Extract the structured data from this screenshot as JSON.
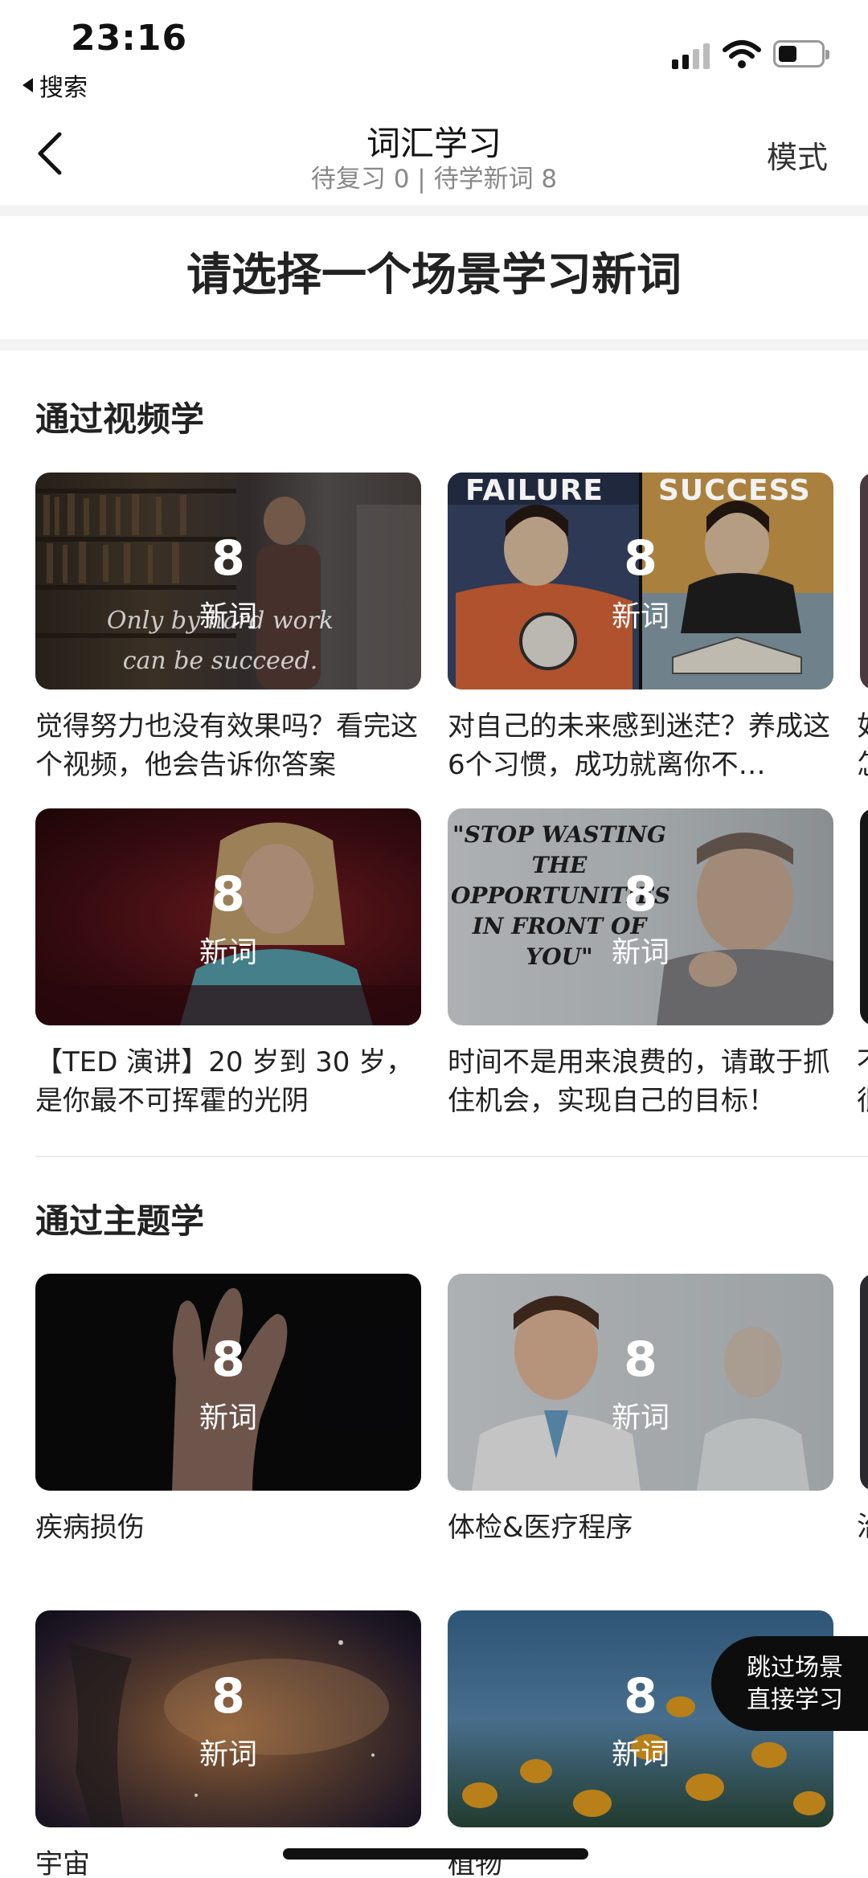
{
  "status_bar": {
    "time": "23:16",
    "back_app": "搜索"
  },
  "nav": {
    "title": "词汇学习",
    "subtitle": "待复习 0 | 待学新词 8",
    "mode_label": "模式"
  },
  "prompt": "请选择一个场景学习新词",
  "video_section": {
    "title": "通过视频学",
    "cards": [
      {
        "count": "8",
        "unit": "新词",
        "caption": "觉得努力也没有效果吗？看完这个视频，他会告诉你答案"
      },
      {
        "count": "8",
        "unit": "新词",
        "caption": "对自己的未来感到迷茫？养成这6个习惯，成功就离你不…"
      },
      {
        "count": "8",
        "unit": "新词",
        "caption": "【TED 演讲】20 岁到 30 岁，是你最不可挥霍的光阴"
      },
      {
        "count": "8",
        "unit": "新词",
        "caption": "时间不是用来浪费的，请敢于抓住机会，实现自己的目标！"
      }
    ],
    "peek_captions": [
      "如怎",
      "不很"
    ]
  },
  "thumb_text": {
    "card1": "Only by hard work can be succeed.",
    "card2_left": "FAILURE",
    "card2_right": "SUCCESS",
    "card4": "\"STOP WASTING THE OPPORTUNITIES IN FRONT OF YOU\""
  },
  "topic_section": {
    "title": "通过主题学",
    "cards": [
      {
        "count": "8",
        "unit": "新词",
        "caption": "疾病损伤"
      },
      {
        "count": "8",
        "unit": "新词",
        "caption": "体检&医疗程序"
      },
      {
        "count": "8",
        "unit": "新词",
        "caption": "宇宙"
      },
      {
        "count": "8",
        "unit": "新词",
        "caption": "植物"
      }
    ],
    "peek_captions": [
      "治"
    ]
  },
  "skip_button": {
    "line1": "跳过场景",
    "line2": "直接学习"
  }
}
